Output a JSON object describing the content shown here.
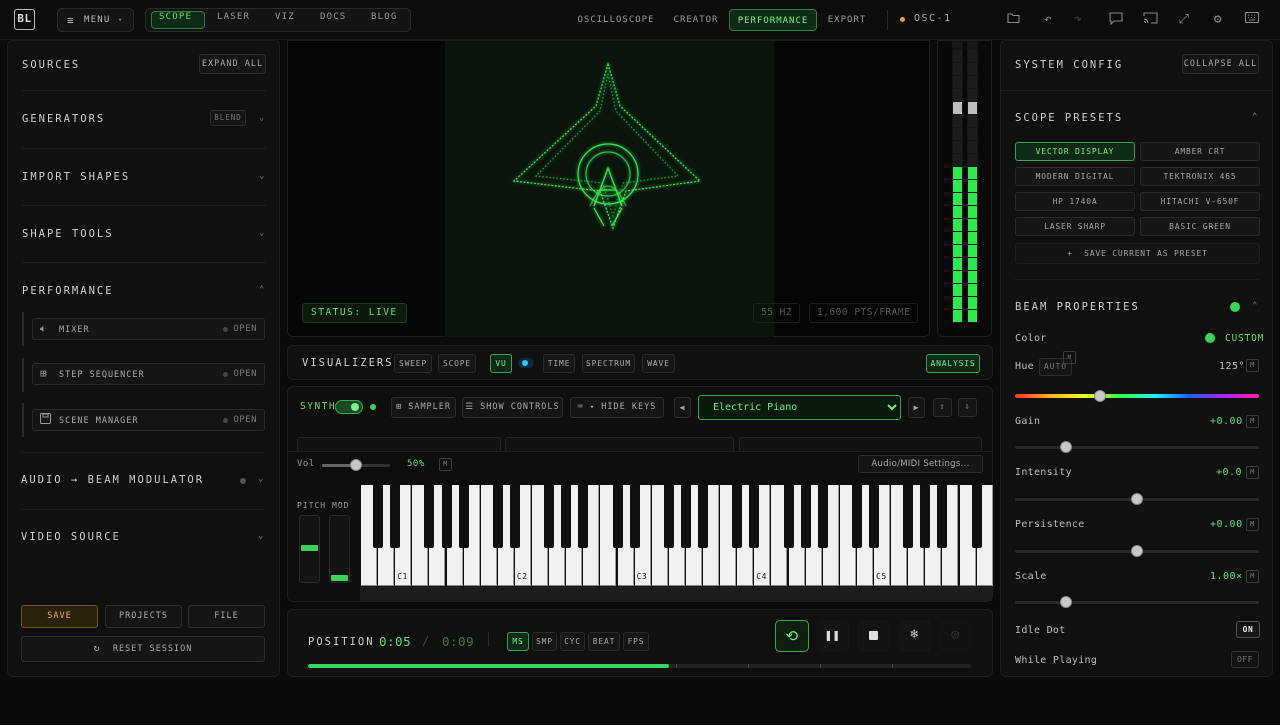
{
  "topbar": {
    "logo": "BL",
    "menu_label": "MENU",
    "nav": [
      {
        "label": "SCOPE",
        "active": true
      },
      {
        "label": "LASER",
        "active": false
      },
      {
        "label": "VIZ",
        "active": false
      },
      {
        "label": "DOCS",
        "active": false
      },
      {
        "label": "BLOG",
        "active": false
      }
    ],
    "modes": [
      {
        "label": "OSCILLOSCOPE",
        "active": false
      },
      {
        "label": "CREATOR",
        "active": false
      },
      {
        "label": "PERFORMANCE",
        "active": true
      },
      {
        "label": "EXPORT",
        "active": false
      }
    ],
    "device": "OSC-1",
    "icons": [
      "folder-icon",
      "undo-icon",
      "redo-icon",
      "chat-icon",
      "cast-icon",
      "fullscreen-icon",
      "gear-icon",
      "keyboard-icon"
    ]
  },
  "sources": {
    "title": "SOURCES",
    "expand_all": "EXPAND ALL",
    "sections": {
      "generators": "GENERATORS",
      "blend": "BLEND",
      "import_shapes": "IMPORT SHAPES",
      "shape_tools": "SHAPE TOOLS",
      "performance": "PERFORMANCE",
      "audio_beam": "AUDIO → BEAM MODULATOR",
      "video_source": "VIDEO SOURCE"
    },
    "performance_items": [
      {
        "label": "MIXER",
        "action": "OPEN",
        "icon": "speaker-icon"
      },
      {
        "label": "STEP SEQUENCER",
        "action": "OPEN",
        "icon": "grid-icon"
      },
      {
        "label": "SCENE MANAGER",
        "action": "OPEN",
        "icon": "save-icon"
      }
    ],
    "save": "SAVE",
    "projects": "PROJECTS",
    "file": "FILE",
    "reset": "RESET SESSION"
  },
  "scope": {
    "status": "STATUS: LIVE",
    "hz": "55 HZ",
    "pts": "1,600 PTS/FRAME",
    "accent": "#39ff5a"
  },
  "visualizers": {
    "title": "VISUALIZERS",
    "buttons": [
      {
        "label": "SWEEP",
        "active": false
      },
      {
        "label": "SCOPE",
        "active": false
      },
      {
        "label": "VU",
        "active": true
      },
      {
        "label": "TIME",
        "active": false
      },
      {
        "label": "SPECTRUM",
        "active": false
      },
      {
        "label": "WAVE",
        "active": false
      }
    ],
    "analysis": "ANALYSIS"
  },
  "synth": {
    "label": "SYNTH",
    "sampler": "SAMPLER",
    "show_controls": "SHOW CONTROLS",
    "hide_keys": "HIDE KEYS",
    "instrument": "Electric Piano",
    "instrument_options": [
      "Electric Piano"
    ],
    "vol_label": "Vol",
    "vol_value": "50%",
    "vol_level": 0.5,
    "m_badge": "M",
    "audio_midi": "Audio/MIDI Settings...",
    "pitch": "PITCH",
    "mod": "MOD",
    "octaves": [
      "C1",
      "C2",
      "C3",
      "C4",
      "C5"
    ]
  },
  "transport": {
    "position_label": "POSITION",
    "current": "0:05",
    "separator": "/",
    "total": "0:09",
    "progress": 0.545,
    "units": [
      {
        "label": "MS",
        "active": true
      },
      {
        "label": "SMP",
        "active": false
      },
      {
        "label": "CYC",
        "active": false
      },
      {
        "label": "BEAT",
        "active": false
      },
      {
        "label": "FPS",
        "active": false
      }
    ]
  },
  "config": {
    "title": "SYSTEM CONFIG",
    "collapse_all": "COLLAPSE ALL",
    "presets_title": "SCOPE PRESETS",
    "presets": [
      {
        "label": "VECTOR DISPLAY",
        "active": true
      },
      {
        "label": "AMBER CRT",
        "active": false
      },
      {
        "label": "MODERN DIGITAL",
        "active": false
      },
      {
        "label": "TEKTRONIX 465",
        "active": false
      },
      {
        "label": "HP 1740A",
        "active": false
      },
      {
        "label": "HITACHI V-650F",
        "active": false
      },
      {
        "label": "LASER SHARP",
        "active": false
      },
      {
        "label": "BASIC GREEN",
        "active": false
      }
    ],
    "save_preset": "SAVE CURRENT AS PRESET",
    "beam_title": "BEAM PROPERTIES",
    "color_label": "Color",
    "color_value": "CUSTOM",
    "hue_label": "Hue",
    "hue_auto": "AUTO",
    "hue_value": "125°",
    "gain_label": "Gain",
    "gain_value": "+0.00",
    "intensity_label": "Intensity",
    "intensity_value": "+0.0",
    "persistence_label": "Persistence",
    "persistence_value": "+0.00",
    "scale_label": "Scale",
    "scale_value": "1.00×",
    "idle_dot_label": "Idle Dot",
    "idle_dot_value": "ON",
    "while_playing_label": "While Playing",
    "while_playing_value": "OFF",
    "sliders": {
      "hue": 0.35,
      "gain": 0.21,
      "intensity": 0.5,
      "persistence": 0.5,
      "scale": 0.21
    }
  }
}
